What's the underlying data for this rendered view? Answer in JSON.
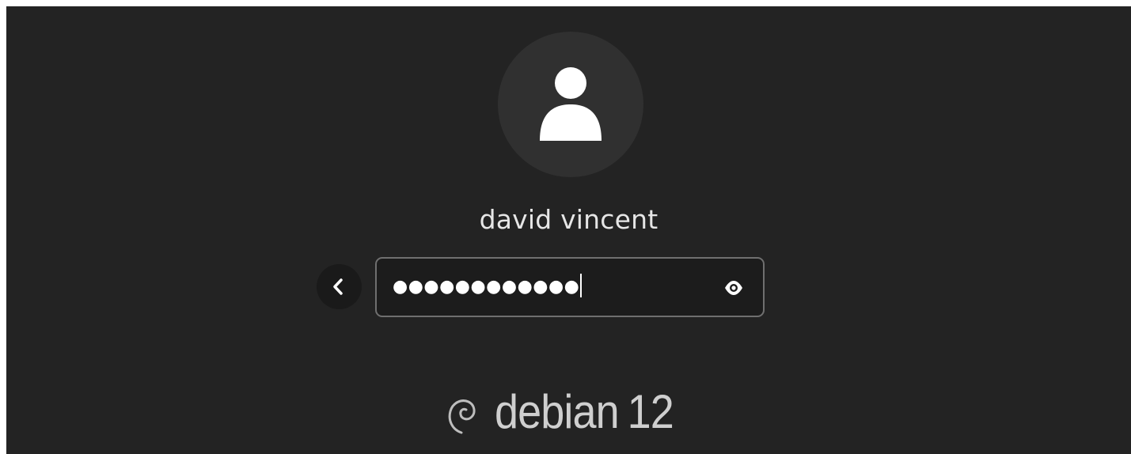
{
  "user": {
    "display_name": "david vincent",
    "avatar_icon": "user-silhouette-icon"
  },
  "login": {
    "password_mask": "●●●●●●●●●●●●",
    "back_icon": "chevron-left-icon",
    "reveal_icon": "eye-icon"
  },
  "branding": {
    "name": "debian",
    "version": "12",
    "logo_icon": "debian-swirl-icon"
  },
  "colors": {
    "background": "#232323",
    "avatar_bg": "#303030",
    "field_border": "#6f6f6f",
    "text": "#e6e6e6"
  }
}
